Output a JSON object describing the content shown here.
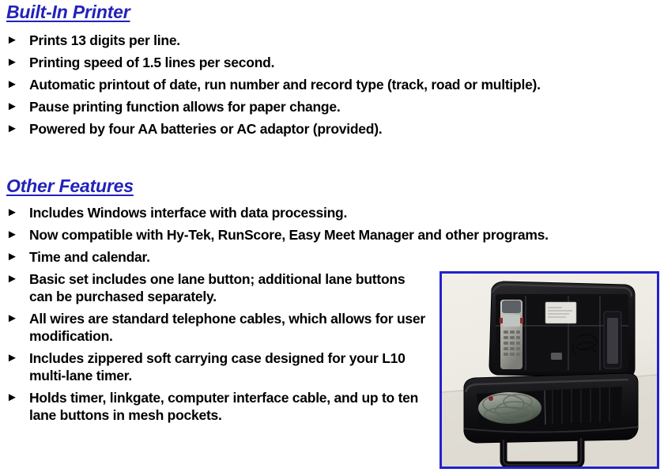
{
  "page": {
    "background_color": "#ffffff",
    "text_color": "#000000",
    "heading_color": "#2222bb"
  },
  "sections": [
    {
      "id": "printer",
      "heading": "Built-In Printer",
      "bullet_glyph": "►",
      "items": [
        "Prints 13 digits per line.",
        "Printing speed of 1.5 lines per second.",
        "Automatic printout of date, run number and record type (track, road or multiple).",
        "Pause printing function allows for paper change.",
        "Powered by four AA batteries or AC adaptor (provided)."
      ]
    },
    {
      "id": "other",
      "heading": "Other Features",
      "bullet_glyph": "►",
      "items": [
        "Includes Windows interface with data processing.",
        "Now compatible with Hy-Tek, RunScore, Easy Meet Manager and other programs.",
        "Time and calendar.",
        "Basic set includes one lane button; additional lane buttons can be purchased separately.",
        "All wires are standard telephone cables, which allows for user modification.",
        "Includes zippered soft carrying case designed for your L10 multi-lane timer.",
        "Holds timer, linkgate, computer interface cable, and up to ten lane buttons in mesh pockets."
      ]
    }
  ],
  "photo": {
    "name": "product-photo-carrying-case",
    "description": "Open black zippered soft carrying case containing a handheld timer, cables and accessories in mesh pockets",
    "border_color": "#2222cc",
    "background_color": "#ece9e2"
  }
}
